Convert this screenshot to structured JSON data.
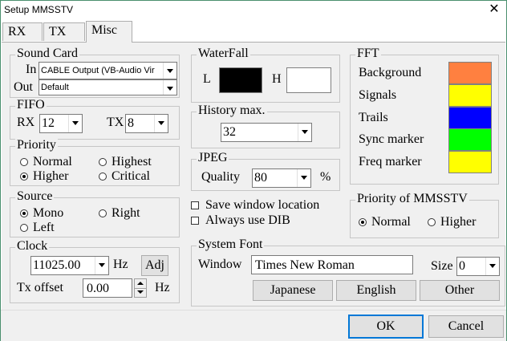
{
  "window": {
    "title": "Setup MMSSTV",
    "close_glyph": "✕"
  },
  "tabs": [
    {
      "label": "RX"
    },
    {
      "label": "TX"
    },
    {
      "label": "Misc"
    }
  ],
  "sound_card": {
    "group_label": "Sound Card",
    "in_label": "In",
    "in_value": "CABLE Output (VB-Audio Vir",
    "out_label": "Out",
    "out_value": "Default"
  },
  "fifo": {
    "group_label": "FIFO",
    "rx_label": "RX",
    "rx_value": "12",
    "tx_label": "TX",
    "tx_value": "8"
  },
  "priority": {
    "group_label": "Priority",
    "options": [
      "Normal",
      "Highest",
      "Higher",
      "Critical"
    ],
    "selected": "Higher"
  },
  "source": {
    "group_label": "Source",
    "options": [
      "Mono",
      "Right",
      "Left"
    ],
    "selected": "Mono"
  },
  "clock": {
    "group_label": "Clock",
    "value": "11025.00",
    "unit": "Hz",
    "adj_label": "Adj",
    "tx_offset_label": "Tx offset",
    "tx_offset_value": "0.00",
    "tx_offset_unit": "Hz"
  },
  "waterfall": {
    "group_label": "WaterFall",
    "l_label": "L",
    "h_label": "H",
    "l_color": "#000000",
    "h_color": "#ffffff"
  },
  "history": {
    "group_label": "History max.",
    "value": "32"
  },
  "jpeg": {
    "group_label": "JPEG",
    "quality_label": "Quality",
    "quality_value": "80",
    "unit": "%"
  },
  "checkboxes": {
    "save_window_location": "Save window location",
    "always_use_dib": "Always use DIB"
  },
  "fft": {
    "group_label": "FFT",
    "items": [
      {
        "label": "Background",
        "color": "#ff8040"
      },
      {
        "label": "Signals",
        "color": "#ffff00"
      },
      {
        "label": "Trails",
        "color": "#0000ff"
      },
      {
        "label": "Sync marker",
        "color": "#00ff00"
      },
      {
        "label": "Freq marker",
        "color": "#ffff00"
      }
    ]
  },
  "priority_mmsstv": {
    "group_label": "Priority of MMSSTV",
    "options": [
      "Normal",
      "Higher"
    ],
    "selected": "Normal"
  },
  "system_font": {
    "group_label": "System Font",
    "window_label": "Window",
    "window_value": "Times New Roman",
    "size_label": "Size",
    "size_value": "0",
    "buttons": [
      "Japanese",
      "English",
      "Other"
    ]
  },
  "footer": {
    "ok_label": "OK",
    "cancel_label": "Cancel"
  }
}
